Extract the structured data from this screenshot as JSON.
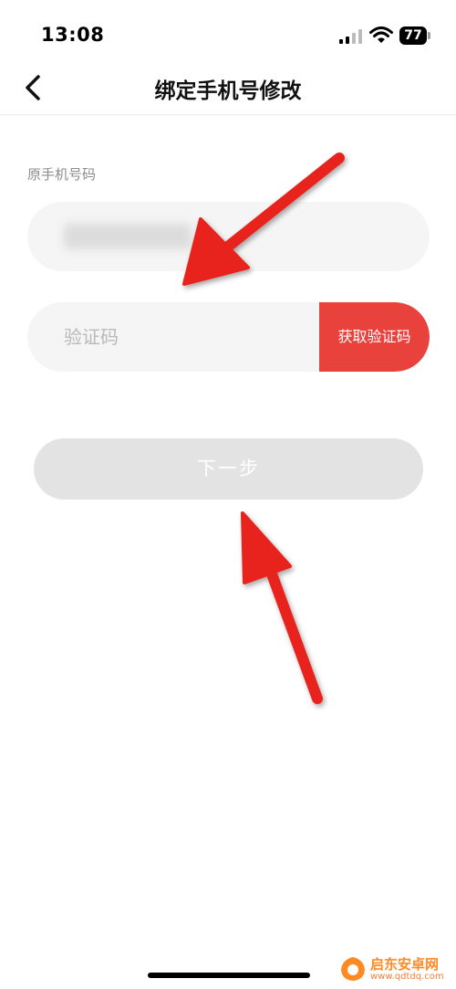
{
  "status_bar": {
    "time": "13:08",
    "battery": "77",
    "icons": [
      "cellular-signal-icon",
      "wifi-icon",
      "battery-icon"
    ]
  },
  "nav": {
    "title": "绑定手机号修改",
    "back_icon": "chevron-left-icon"
  },
  "form": {
    "phone_label": "原手机号码",
    "code_placeholder": "验证码",
    "get_code_label": "获取验证码",
    "next_label": "下一步"
  },
  "watermark": {
    "name": "启东安卓网",
    "url": "www.qdtdq.com"
  },
  "colors": {
    "accent": "#e9413b",
    "annotation_arrow": "#e8221c",
    "field_bg": "#f5f5f5",
    "disabled_button_bg": "#e3e3e3"
  }
}
